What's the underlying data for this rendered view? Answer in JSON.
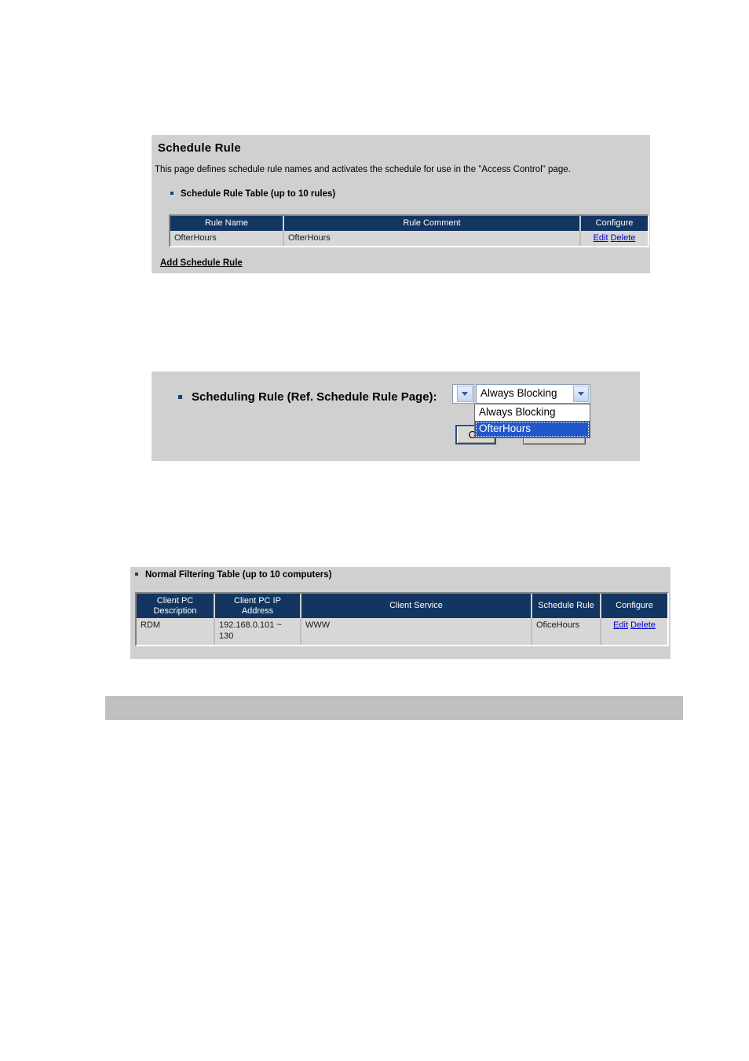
{
  "schedule_rule_panel": {
    "title": "Schedule Rule",
    "description": "This page defines schedule rule names and activates the schedule for use in the \"Access Control\" page.",
    "table_caption": "Schedule Rule Table (up to 10 rules)",
    "columns": [
      "Rule Name",
      "Rule Comment",
      "Configure"
    ],
    "rows": [
      {
        "rule_name": "OfterHours",
        "rule_comment": "OfterHours",
        "edit_label": "Edit",
        "delete_label": "Delete"
      }
    ],
    "add_link": "Add Schedule Rule"
  },
  "scheduling_rule_panel": {
    "label": "Scheduling Rule (Ref. Schedule Rule Page):",
    "mini_select_value": "",
    "selected_value": "Always Blocking",
    "options": [
      {
        "label": "Always Blocking",
        "selected": false
      },
      {
        "label": "OfterHours",
        "selected": true
      }
    ],
    "ok_label": "OK",
    "cancel_label": "Cancel"
  },
  "filtering_panel": {
    "table_caption": "Normal Filtering Table (up to 10 computers)",
    "columns": [
      "Client PC Description",
      "Client PC IP Address",
      "Client Service",
      "Schedule Rule",
      "Configure"
    ],
    "rows": [
      {
        "description": "RDM",
        "ip_address": "192.168.0.101 ~ 130",
        "service": "WWW",
        "schedule_rule": "OficeHours",
        "edit_label": "Edit",
        "delete_label": "Delete"
      }
    ]
  },
  "colors": {
    "header_navy": "#123561",
    "panel_grey": "#d0d0d0",
    "link_blue": "#0000cc",
    "highlight_blue": "#2158c9",
    "bottom_bar_grey": "#c0c0c0"
  }
}
